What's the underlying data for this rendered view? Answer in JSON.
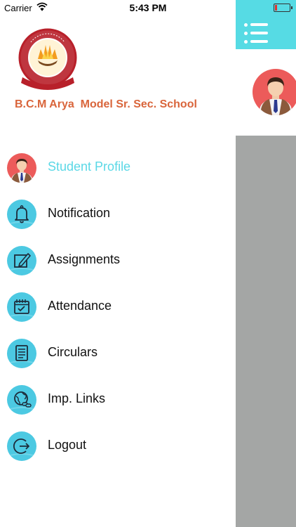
{
  "status_bar": {
    "carrier": "Carrier",
    "time": "5:43 PM"
  },
  "school": {
    "name": "B.C.M Arya  Model Sr. Sec. School",
    "logo_text": "BAHADUR CHAND MUNJAL ARYA MODEL SR. SEC. SCHOOL"
  },
  "menu": [
    {
      "label": "Student Profile",
      "icon": "student-avatar-icon",
      "active": true
    },
    {
      "label": "Notification",
      "icon": "bell-icon"
    },
    {
      "label": "Assignments",
      "icon": "edit-note-icon"
    },
    {
      "label": "Attendance",
      "icon": "calendar-check-icon"
    },
    {
      "label": "Circulars",
      "icon": "document-icon"
    },
    {
      "label": "Imp. Links",
      "icon": "globe-link-icon"
    },
    {
      "label": "Logout",
      "icon": "logout-icon"
    }
  ],
  "colors": {
    "accent": "#56dbe4",
    "school_name": "#d9653b",
    "overlay": "#a4a6a5",
    "icon_bg": "#4cc9e2"
  }
}
